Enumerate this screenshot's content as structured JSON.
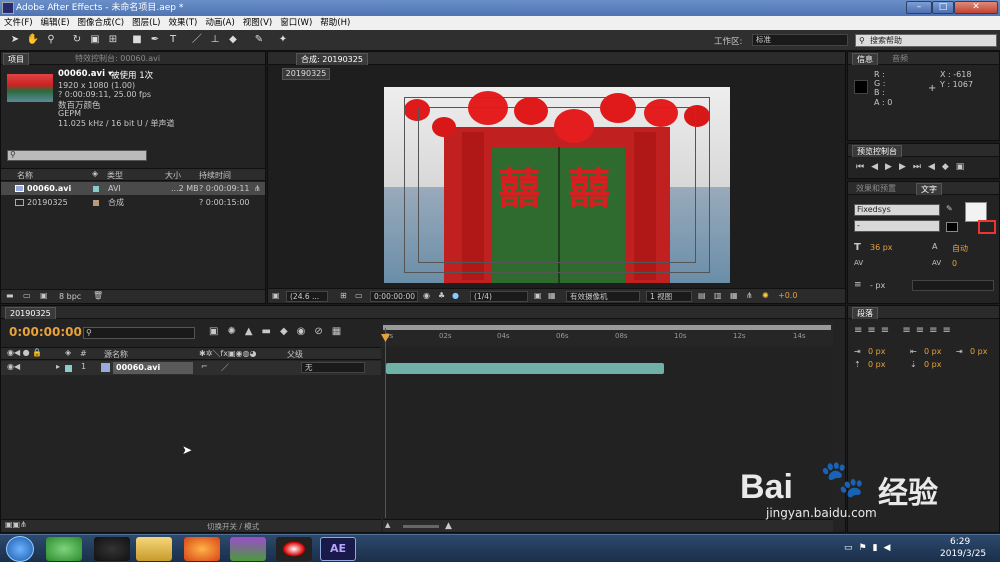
{
  "window": {
    "title": "Adobe After Effects - 未命名项目.aep *",
    "buttons": [
      "–",
      "□",
      "✕"
    ]
  },
  "menu": [
    "文件(F)",
    "编辑(E)",
    "图像合成(C)",
    "图层(L)",
    "效果(T)",
    "动画(A)",
    "视图(V)",
    "窗口(W)",
    "帮助(H)"
  ],
  "toolbar": {
    "workspace_label": "工作区:",
    "workspace_value": "标准",
    "search_placeholder": "搜索帮助"
  },
  "project_panel": {
    "tab_project": "项目",
    "tab_effects": "特效控制台: 00060.avi",
    "file_name": "00060.avi ▾",
    "used_count": "被使用 1次",
    "info_lines": [
      "1920 x 1080 (1.00)",
      "? 0:00:09:11, 25.00 fps",
      "数百万颜色",
      "GEPM",
      "11.025 kHz / 16 bit U / 单声道"
    ],
    "columns": {
      "name": "名称",
      "type": "类型",
      "size": "大小",
      "duration": "持续时间"
    },
    "items": [
      {
        "name": "00060.avi",
        "type": "AVI",
        "size": "...2 MB",
        "duration": "? 0:00:09:11"
      },
      {
        "name": "20190325",
        "type": "合成",
        "size": "",
        "duration": "? 0:00:15:00"
      }
    ],
    "bpc": "8 bpc"
  },
  "comp_panel": {
    "tab": "合成: 20190325",
    "sub_tab": "20190325",
    "zoom": "(24.6 ...",
    "timecode": "0:00:00:00",
    "resolution": "(1/4)",
    "camera": "有效摄像机",
    "views": "1 视图",
    "exposure": "+0.0",
    "chars": [
      "囍",
      "囍"
    ]
  },
  "info_panel": {
    "tab_info": "信息",
    "tab_audio": "音频",
    "r": "R :",
    "g": "G :",
    "b": "B :",
    "a": "A : 0",
    "x": "X : -618",
    "y": "Y : 1067"
  },
  "preview_panel": {
    "tab": "预览控制台"
  },
  "effects_panel": {
    "tab_effects": "效果和预置",
    "tab_text": "文字",
    "font": "Fixedsys",
    "font_style": "-",
    "size": "36 px",
    "leading": "自动",
    "kerning": "0",
    "stroke": "- px"
  },
  "paragraph_panel": {
    "tab": "段落",
    "values": [
      "0 px",
      "0 px",
      "0 px",
      "0 px",
      "0 px"
    ]
  },
  "timeline": {
    "tab": "20190325",
    "timecode": "0:00:00:00",
    "ruler": [
      "0s",
      "02s",
      "04s",
      "06s",
      "08s",
      "10s",
      "12s",
      "14s"
    ],
    "columns": {
      "source": "源名称",
      "parent": "父级"
    },
    "layer": {
      "index": "1",
      "name": "00060.avi",
      "parent": "无"
    },
    "footer": "切换开关 / 模式"
  },
  "taskbar": {
    "time": "6:29",
    "date": "2019/3/25",
    "ae_label": "AE"
  },
  "watermark": {
    "brand": "Bai",
    "brand2": "经验",
    "url": "jingyan.baidu.com"
  },
  "colors": {
    "accent": "#e8a23a",
    "layer_bar": "#6fb1a6"
  }
}
